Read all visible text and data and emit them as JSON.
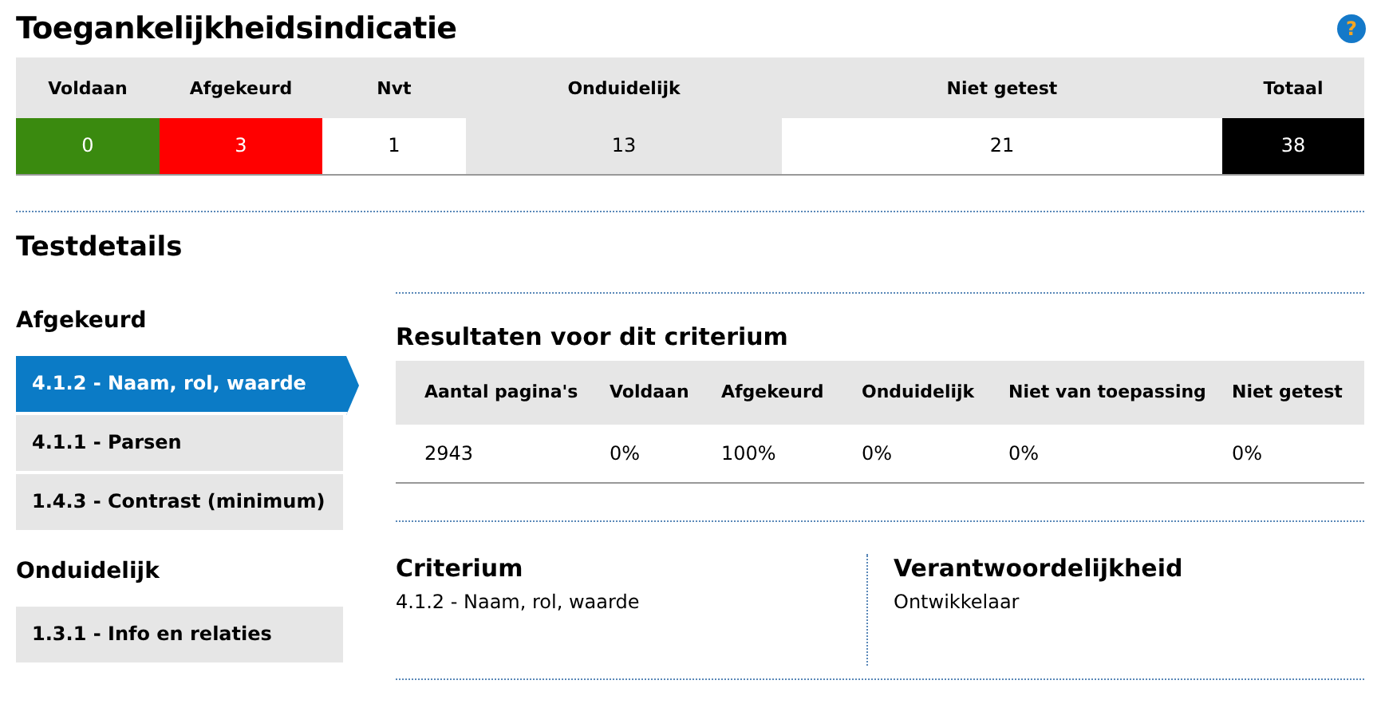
{
  "title": "Toegankelijkheidsindicatie",
  "help": "?",
  "summary": [
    {
      "label": "Voldaan",
      "value": "0",
      "color": "#3a8a0f"
    },
    {
      "label": "Afgekeurd",
      "value": "3",
      "color": "#ff0000"
    },
    {
      "label": "Nvt",
      "value": "1",
      "color": "#ffffff"
    },
    {
      "label": "Onduidelijk",
      "value": "13",
      "color": "#e6e6e6"
    },
    {
      "label": "Niet getest",
      "value": "21",
      "color": "#ffffff"
    },
    {
      "label": "Totaal",
      "value": "38",
      "color": "#000000"
    }
  ],
  "details_title": "Testdetails",
  "sidebar": [
    {
      "heading": "Afgekeurd",
      "items": [
        {
          "label": "4.1.2 - Naam, rol, waarde",
          "selected": true
        },
        {
          "label": "4.1.1 - Parsen",
          "selected": false
        },
        {
          "label": "1.4.3 - Contrast (minimum)",
          "selected": false
        }
      ]
    },
    {
      "heading": "Onduidelijk",
      "items": [
        {
          "label": "1.3.1 - Info en relaties",
          "selected": false
        }
      ]
    }
  ],
  "results": {
    "title": "Resultaten voor dit criterium",
    "columns": [
      "Aantal pagina's",
      "Voldaan",
      "Afgekeurd",
      "Onduidelijk",
      "Niet van toepassing",
      "Niet getest"
    ],
    "row": [
      "2943",
      "0%",
      "100%",
      "0%",
      "0%",
      "0%"
    ]
  },
  "criterium": {
    "heading": "Criterium",
    "text": "4.1.2 - Naam, rol, waarde"
  },
  "responsibility": {
    "heading": "Verantwoordelijkheid",
    "text": "Ontwikkelaar"
  }
}
